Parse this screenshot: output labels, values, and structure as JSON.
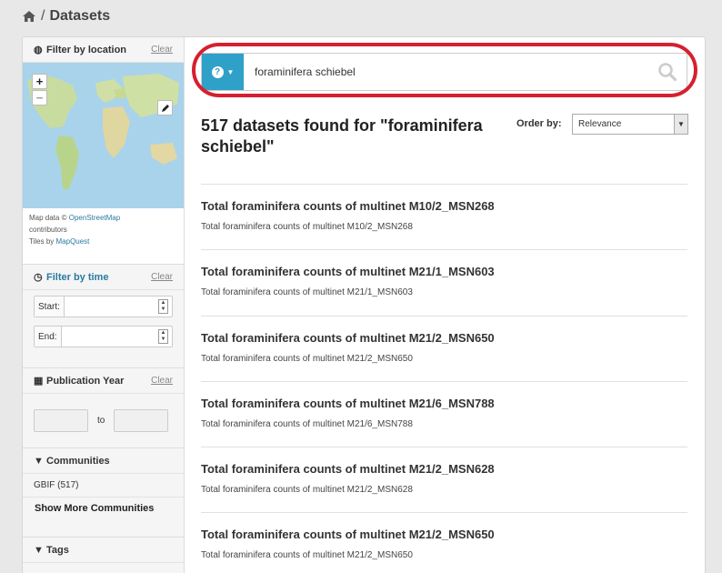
{
  "breadcrumb": {
    "separator": "/",
    "title": "Datasets"
  },
  "sidebar": {
    "location": {
      "title": "Filter by location",
      "clear": "Clear"
    },
    "map": {
      "zoom_in": "+",
      "zoom_out": "−",
      "attribution_prefix": "Map data ©",
      "osm_link": "OpenStreetMap",
      "contributors": "contributors",
      "tiles_prefix": "Tiles by",
      "mapquest_link": "MapQuest"
    },
    "time": {
      "title": "Filter by time",
      "clear": "Clear",
      "start_label": "Start:",
      "end_label": "End:"
    },
    "publication_year": {
      "title": "Publication Year",
      "clear": "Clear",
      "to": "to"
    },
    "communities": {
      "title": "Communities",
      "items": [
        "GBIF (517)"
      ],
      "show_more": "Show More Communities"
    },
    "tags": {
      "title": "Tags"
    }
  },
  "search": {
    "query": "foraminifera schiebel"
  },
  "results": {
    "heading": "517 datasets found for \"foraminifera schiebel\"",
    "order_label": "Order by:",
    "order_value": "Relevance",
    "items": [
      {
        "title": "Total foraminifera counts of multinet M10/2_MSN268",
        "desc": "Total foraminifera counts of multinet M10/2_MSN268"
      },
      {
        "title": "Total foraminifera counts of multinet M21/1_MSN603",
        "desc": "Total foraminifera counts of multinet M21/1_MSN603"
      },
      {
        "title": "Total foraminifera counts of multinet M21/2_MSN650",
        "desc": "Total foraminifera counts of multinet M21/2_MSN650"
      },
      {
        "title": "Total foraminifera counts of multinet M21/6_MSN788",
        "desc": "Total foraminifera counts of multinet M21/6_MSN788"
      },
      {
        "title": "Total foraminifera counts of multinet M21/2_MSN628",
        "desc": "Total foraminifera counts of multinet M21/2_MSN628"
      },
      {
        "title": "Total foraminifera counts of multinet M21/2_MSN650",
        "desc": "Total foraminifera counts of multinet M21/2_MSN650"
      }
    ]
  },
  "colors": {
    "accent": "#2fa0c7",
    "highlight": "#d52030",
    "link": "#2a7aa0"
  },
  "icons": [
    "home-icon",
    "globe-icon",
    "pencil-icon",
    "clock-icon",
    "calendar-icon",
    "filter-icon",
    "question-icon",
    "search-icon"
  ]
}
